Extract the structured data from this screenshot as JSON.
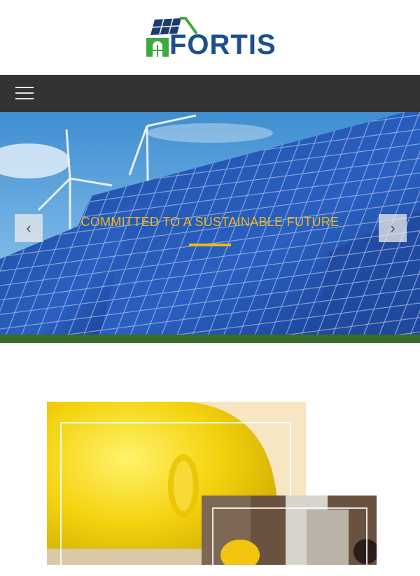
{
  "brand": {
    "name": "FORTIS",
    "colors": {
      "text": "#1d4f8e",
      "house": "#3dab3d",
      "panel": "#1d3b6e"
    }
  },
  "nav": {
    "menu_icon": "hamburger-menu-icon"
  },
  "hero": {
    "title": "COMMITTED TO A SUSTAINABLE FUTURE",
    "accent_color": "#f0b81a",
    "prev_label": "‹",
    "next_label": "›"
  },
  "content": {
    "image_subject": "hard-hat"
  }
}
